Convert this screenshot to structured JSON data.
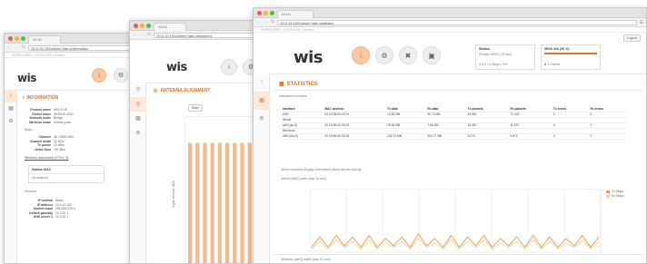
{
  "windows": [
    {
      "tab_title": "W.1N",
      "url": "10.0.10.100/admin?tab=information",
      "banner": "SUPERUSER • 10.0.10.100 • Version",
      "section_title": "INFORMATION",
      "info_rows": [
        {
          "k": "Product name",
          "v": "WIS 5 GE"
        },
        {
          "k": "Device name",
          "v": "WIS5GE-0001"
        },
        {
          "k": "Network mode",
          "v": "Bridge"
        },
        {
          "k": "Wireless mode",
          "v": "Access point"
        }
      ],
      "wireless_title": "Basic",
      "wireless_rows": [
        {
          "k": "Channel",
          "v": "36 / 5180 MHz"
        },
        {
          "k": "Channel width",
          "v": "40 MHz"
        },
        {
          "k": "Tx power",
          "v": "23 dBm"
        },
        {
          "k": "Noise floor",
          "v": "-95 dBm"
        }
      ],
      "link_text": "Wireless associated (OTL0, 2)",
      "table_header": "Station MAC",
      "table_row": "No stations",
      "network_title": "Network",
      "network_rows": [
        {
          "k": "IP method",
          "v": "Static"
        },
        {
          "k": "IP address",
          "v": "10.0.10.100"
        },
        {
          "k": "Subnet mask",
          "v": "255.255.255.0"
        },
        {
          "k": "Default gateway",
          "v": "10.0.10.1"
        },
        {
          "k": "DNS server 1",
          "v": "10.0.10.1"
        }
      ]
    },
    {
      "tab_title": "W.1N",
      "url": "10.0.10.100/admin?tab=alignment",
      "section_title": "ANTENNA ALIGNMENT",
      "button_label": "Start",
      "y_axis_label": "Signal strength, dBm",
      "bars": [
        82,
        82,
        82,
        82,
        82,
        82,
        82,
        82,
        82,
        82
      ]
    },
    {
      "tab_title": "W.1N",
      "url": "10.0.10.100/admin?tab=statistics",
      "banner": "SUPERUSER • 10.0.10.100 • Version",
      "logout_label": "Logout",
      "header_left_title": "Station",
      "header_left_sub": "Private-00001 (30 sec)",
      "header_left_status": "0.0 / 0 Mbps / 0%",
      "header_right_title": "WIS5 link (30 %)",
      "header_right_status": "1 Clients",
      "section_title": "STATISTICS",
      "sub_title": "Interfaces counters",
      "table": {
        "headers": [
          "Interface",
          "MAC address",
          "Tx data",
          "Rx data",
          "Tx packets",
          "Rx packets",
          "Tx errors",
          "Rx errors"
        ],
        "rows": [
          {
            "type": "row",
            "cells": [
              "eth0",
              "00:19:3B:00:00:01",
              "13.86 MB",
              "92.74 MB",
              "63 684",
              "71 029",
              "0",
              "0"
            ]
          },
          {
            "type": "group",
            "cells": [
              "Wired",
              "",
              "",
              "",
              "",
              "",
              "",
              ""
            ]
          },
          {
            "type": "row",
            "cells": [
              "ath0 (ap-0)",
              "00:19:3B:00:00:02",
              "28.46 MB",
              "7.85 MB",
              "15 307",
              "11 872",
              "0",
              "0"
            ]
          },
          {
            "type": "group",
            "cells": [
              "Wireless",
              "",
              "",
              "",
              "",
              "",
              "",
              ""
            ]
          },
          {
            "type": "row",
            "cells": [
              "ath0 (sta-0)",
              "00:19:3B:00:00:03",
              "145.70 MB",
              "200.77 MB",
              "8 271",
              "9 874",
              "0",
              "0"
            ]
          }
        ]
      },
      "note": "Wired counters display information about device activity",
      "chart_title": "Wired (eth0) traffic (last 15 min)",
      "legend": [
        {
          "name": "Tx Mbps",
          "color": "#f6a04d"
        },
        {
          "name": "Rx Mbps",
          "color": "#f9cc99"
        }
      ],
      "chart2_title": "Wireless (ath0) traffic (last 15 min)"
    }
  ],
  "chart_data": {
    "type": "line",
    "title": "Wired (eth0) traffic (last 15 min)",
    "series": [
      {
        "name": "Tx Mbps",
        "values": [
          2,
          9,
          2,
          10,
          3,
          9,
          2,
          10,
          2,
          8,
          3,
          9,
          2,
          11,
          3,
          8,
          2,
          10,
          2,
          9,
          3,
          10,
          2,
          8,
          3,
          9,
          2,
          10,
          2,
          9,
          2,
          8,
          3,
          10,
          2,
          9
        ]
      },
      {
        "name": "Rx Mbps",
        "values": [
          1,
          6,
          1,
          7,
          2,
          6,
          1,
          7,
          1,
          5,
          2,
          6,
          1,
          8,
          2,
          5,
          1,
          7,
          1,
          6,
          2,
          7,
          1,
          5,
          2,
          6,
          1,
          7,
          1,
          6,
          1,
          5,
          2,
          7,
          1,
          6
        ]
      }
    ],
    "ylim": [
      0,
      40
    ],
    "grid": true,
    "legend_position": "top-right"
  }
}
